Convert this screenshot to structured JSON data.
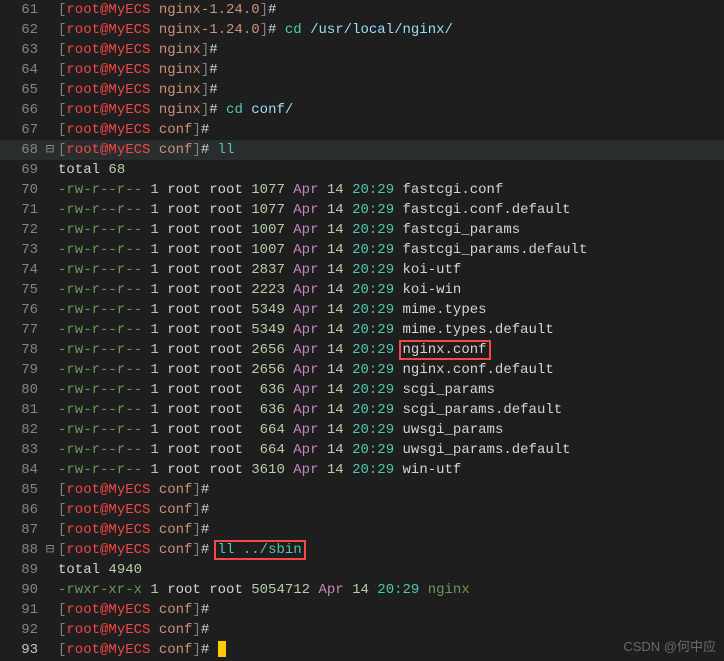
{
  "lines": [
    {
      "n": 61,
      "segs": [
        {
          "t": "[",
          "c": "c-br"
        },
        {
          "t": "root@MyECS",
          "c": "c-red"
        },
        {
          "t": " nginx-1.24.0",
          "c": "c-user"
        },
        {
          "t": "]",
          "c": "c-br"
        },
        {
          "t": "#",
          "c": "c-hash"
        },
        {
          "t": " ",
          "c": ""
        }
      ]
    },
    {
      "n": 62,
      "segs": [
        {
          "t": "[",
          "c": "c-br"
        },
        {
          "t": "root@MyECS",
          "c": "c-red"
        },
        {
          "t": " nginx-1.24.0",
          "c": "c-user"
        },
        {
          "t": "]",
          "c": "c-br"
        },
        {
          "t": "#",
          "c": "c-hash"
        },
        {
          "t": " cd",
          "c": "c-cmd"
        },
        {
          "t": " /usr/local/nginx/",
          "c": "c-dir"
        }
      ]
    },
    {
      "n": 63,
      "segs": [
        {
          "t": "[",
          "c": "c-br"
        },
        {
          "t": "root@MyECS",
          "c": "c-red"
        },
        {
          "t": " nginx",
          "c": "c-user"
        },
        {
          "t": "]",
          "c": "c-br"
        },
        {
          "t": "#",
          "c": "c-hash"
        }
      ]
    },
    {
      "n": 64,
      "segs": [
        {
          "t": "[",
          "c": "c-br"
        },
        {
          "t": "root@MyECS",
          "c": "c-red"
        },
        {
          "t": " nginx",
          "c": "c-user"
        },
        {
          "t": "]",
          "c": "c-br"
        },
        {
          "t": "#",
          "c": "c-hash"
        }
      ]
    },
    {
      "n": 65,
      "segs": [
        {
          "t": "[",
          "c": "c-br"
        },
        {
          "t": "root@MyECS",
          "c": "c-red"
        },
        {
          "t": " nginx",
          "c": "c-user"
        },
        {
          "t": "]",
          "c": "c-br"
        },
        {
          "t": "#",
          "c": "c-hash"
        }
      ]
    },
    {
      "n": 66,
      "segs": [
        {
          "t": "[",
          "c": "c-br"
        },
        {
          "t": "root@MyECS",
          "c": "c-red"
        },
        {
          "t": " nginx",
          "c": "c-user"
        },
        {
          "t": "]",
          "c": "c-br"
        },
        {
          "t": "#",
          "c": "c-hash"
        },
        {
          "t": " cd",
          "c": "c-cmd"
        },
        {
          "t": " conf/",
          "c": "c-dir"
        }
      ]
    },
    {
      "n": 67,
      "segs": [
        {
          "t": "[",
          "c": "c-br"
        },
        {
          "t": "root@MyECS",
          "c": "c-red"
        },
        {
          "t": " conf",
          "c": "c-user"
        },
        {
          "t": "]",
          "c": "c-br"
        },
        {
          "t": "#",
          "c": "c-hash"
        }
      ]
    },
    {
      "n": 68,
      "fold": "⊟",
      "hl": true,
      "segs": [
        {
          "t": "[",
          "c": "c-br"
        },
        {
          "t": "root@MyECS",
          "c": "c-red"
        },
        {
          "t": " conf",
          "c": "c-user"
        },
        {
          "t": "]",
          "c": "c-br"
        },
        {
          "t": "#",
          "c": "c-hash"
        },
        {
          "t": " ll",
          "c": "c-cmd"
        }
      ]
    },
    {
      "n": 69,
      "segs": [
        {
          "t": "total ",
          "c": "c-file"
        },
        {
          "t": "68",
          "c": "c-num"
        }
      ]
    },
    {
      "n": 70,
      "segs": [
        {
          "t": "-rw-r--r--",
          "c": "c-green"
        },
        {
          "t": " 1",
          "c": "c-num"
        },
        {
          "t": " root root ",
          "c": "c-file"
        },
        {
          "t": "1077",
          "c": "c-num"
        },
        {
          "t": " Apr",
          "c": "c-mon"
        },
        {
          "t": " 14",
          "c": "c-day"
        },
        {
          "t": " 20:29",
          "c": "c-time"
        },
        {
          "t": " fastcgi.conf",
          "c": "c-file"
        }
      ]
    },
    {
      "n": 71,
      "segs": [
        {
          "t": "-rw-r--r--",
          "c": "c-green"
        },
        {
          "t": " 1",
          "c": "c-num"
        },
        {
          "t": " root root ",
          "c": "c-file"
        },
        {
          "t": "1077",
          "c": "c-num"
        },
        {
          "t": " Apr",
          "c": "c-mon"
        },
        {
          "t": " 14",
          "c": "c-day"
        },
        {
          "t": " 20:29",
          "c": "c-time"
        },
        {
          "t": " fastcgi.conf.default",
          "c": "c-file"
        }
      ]
    },
    {
      "n": 72,
      "segs": [
        {
          "t": "-rw-r--r--",
          "c": "c-green"
        },
        {
          "t": " 1",
          "c": "c-num"
        },
        {
          "t": " root root ",
          "c": "c-file"
        },
        {
          "t": "1007",
          "c": "c-num"
        },
        {
          "t": " Apr",
          "c": "c-mon"
        },
        {
          "t": " 14",
          "c": "c-day"
        },
        {
          "t": " 20:29",
          "c": "c-time"
        },
        {
          "t": " fastcgi_params",
          "c": "c-file"
        }
      ]
    },
    {
      "n": 73,
      "segs": [
        {
          "t": "-rw-r--r--",
          "c": "c-green"
        },
        {
          "t": " 1",
          "c": "c-num"
        },
        {
          "t": " root root ",
          "c": "c-file"
        },
        {
          "t": "1007",
          "c": "c-num"
        },
        {
          "t": " Apr",
          "c": "c-mon"
        },
        {
          "t": " 14",
          "c": "c-day"
        },
        {
          "t": " 20:29",
          "c": "c-time"
        },
        {
          "t": " fastcgi_params.default",
          "c": "c-file"
        }
      ]
    },
    {
      "n": 74,
      "segs": [
        {
          "t": "-rw-r--r--",
          "c": "c-green"
        },
        {
          "t": " 1",
          "c": "c-num"
        },
        {
          "t": " root root ",
          "c": "c-file"
        },
        {
          "t": "2837",
          "c": "c-num"
        },
        {
          "t": " Apr",
          "c": "c-mon"
        },
        {
          "t": " 14",
          "c": "c-day"
        },
        {
          "t": " 20:29",
          "c": "c-time"
        },
        {
          "t": " koi-utf",
          "c": "c-file"
        }
      ]
    },
    {
      "n": 75,
      "segs": [
        {
          "t": "-rw-r--r--",
          "c": "c-green"
        },
        {
          "t": " 1",
          "c": "c-num"
        },
        {
          "t": " root root ",
          "c": "c-file"
        },
        {
          "t": "2223",
          "c": "c-num"
        },
        {
          "t": " Apr",
          "c": "c-mon"
        },
        {
          "t": " 14",
          "c": "c-day"
        },
        {
          "t": " 20:29",
          "c": "c-time"
        },
        {
          "t": " koi-win",
          "c": "c-file"
        }
      ]
    },
    {
      "n": 76,
      "segs": [
        {
          "t": "-rw-r--r--",
          "c": "c-green"
        },
        {
          "t": " 1",
          "c": "c-num"
        },
        {
          "t": " root root ",
          "c": "c-file"
        },
        {
          "t": "5349",
          "c": "c-num"
        },
        {
          "t": " Apr",
          "c": "c-mon"
        },
        {
          "t": " 14",
          "c": "c-day"
        },
        {
          "t": " 20:29",
          "c": "c-time"
        },
        {
          "t": " mime.types",
          "c": "c-file"
        }
      ]
    },
    {
      "n": 77,
      "segs": [
        {
          "t": "-rw-r--r--",
          "c": "c-green"
        },
        {
          "t": " 1",
          "c": "c-num"
        },
        {
          "t": " root root ",
          "c": "c-file"
        },
        {
          "t": "5349",
          "c": "c-num"
        },
        {
          "t": " Apr",
          "c": "c-mon"
        },
        {
          "t": " 14",
          "c": "c-day"
        },
        {
          "t": " 20:29",
          "c": "c-time"
        },
        {
          "t": " mime.types.default",
          "c": "c-file"
        }
      ]
    },
    {
      "n": 78,
      "segs": [
        {
          "t": "-rw-r--r--",
          "c": "c-green"
        },
        {
          "t": " 1",
          "c": "c-num"
        },
        {
          "t": " root root ",
          "c": "c-file"
        },
        {
          "t": "2656",
          "c": "c-num"
        },
        {
          "t": " Apr",
          "c": "c-mon"
        },
        {
          "t": " 14",
          "c": "c-day"
        },
        {
          "t": " 20:29",
          "c": "c-time"
        },
        {
          "t": " ",
          "c": ""
        },
        {
          "t": "nginx.conf",
          "c": "c-file",
          "box": true
        }
      ]
    },
    {
      "n": 79,
      "segs": [
        {
          "t": "-rw-r--r--",
          "c": "c-green"
        },
        {
          "t": " 1",
          "c": "c-num"
        },
        {
          "t": " root root ",
          "c": "c-file"
        },
        {
          "t": "2656",
          "c": "c-num"
        },
        {
          "t": " Apr",
          "c": "c-mon"
        },
        {
          "t": " 14",
          "c": "c-day"
        },
        {
          "t": " 20:29",
          "c": "c-time"
        },
        {
          "t": " nginx.conf.default",
          "c": "c-file"
        }
      ]
    },
    {
      "n": 80,
      "segs": [
        {
          "t": "-rw-r--r--",
          "c": "c-green"
        },
        {
          "t": " 1",
          "c": "c-num"
        },
        {
          "t": " root root  ",
          "c": "c-file"
        },
        {
          "t": "636",
          "c": "c-num"
        },
        {
          "t": " Apr",
          "c": "c-mon"
        },
        {
          "t": " 14",
          "c": "c-day"
        },
        {
          "t": " 20:29",
          "c": "c-time"
        },
        {
          "t": " scgi_params",
          "c": "c-file"
        }
      ]
    },
    {
      "n": 81,
      "segs": [
        {
          "t": "-rw-r--r--",
          "c": "c-green"
        },
        {
          "t": " 1",
          "c": "c-num"
        },
        {
          "t": " root root  ",
          "c": "c-file"
        },
        {
          "t": "636",
          "c": "c-num"
        },
        {
          "t": " Apr",
          "c": "c-mon"
        },
        {
          "t": " 14",
          "c": "c-day"
        },
        {
          "t": " 20:29",
          "c": "c-time"
        },
        {
          "t": " scgi_params.default",
          "c": "c-file"
        }
      ]
    },
    {
      "n": 82,
      "segs": [
        {
          "t": "-rw-r--r--",
          "c": "c-green"
        },
        {
          "t": " 1",
          "c": "c-num"
        },
        {
          "t": " root root  ",
          "c": "c-file"
        },
        {
          "t": "664",
          "c": "c-num"
        },
        {
          "t": " Apr",
          "c": "c-mon"
        },
        {
          "t": " 14",
          "c": "c-day"
        },
        {
          "t": " 20:29",
          "c": "c-time"
        },
        {
          "t": " uwsgi_params",
          "c": "c-file"
        }
      ]
    },
    {
      "n": 83,
      "segs": [
        {
          "t": "-rw-r--r--",
          "c": "c-green"
        },
        {
          "t": " 1",
          "c": "c-num"
        },
        {
          "t": " root root  ",
          "c": "c-file"
        },
        {
          "t": "664",
          "c": "c-num"
        },
        {
          "t": " Apr",
          "c": "c-mon"
        },
        {
          "t": " 14",
          "c": "c-day"
        },
        {
          "t": " 20:29",
          "c": "c-time"
        },
        {
          "t": " uwsgi_params.default",
          "c": "c-file"
        }
      ]
    },
    {
      "n": 84,
      "segs": [
        {
          "t": "-rw-r--r--",
          "c": "c-green"
        },
        {
          "t": " 1",
          "c": "c-num"
        },
        {
          "t": " root root ",
          "c": "c-file"
        },
        {
          "t": "3610",
          "c": "c-num"
        },
        {
          "t": " Apr",
          "c": "c-mon"
        },
        {
          "t": " 14",
          "c": "c-day"
        },
        {
          "t": " 20:29",
          "c": "c-time"
        },
        {
          "t": " win-utf",
          "c": "c-file"
        }
      ]
    },
    {
      "n": 85,
      "segs": [
        {
          "t": "[",
          "c": "c-br"
        },
        {
          "t": "root@MyECS",
          "c": "c-red"
        },
        {
          "t": " conf",
          "c": "c-user"
        },
        {
          "t": "]",
          "c": "c-br"
        },
        {
          "t": "#",
          "c": "c-hash"
        }
      ]
    },
    {
      "n": 86,
      "segs": [
        {
          "t": "[",
          "c": "c-br"
        },
        {
          "t": "root@MyECS",
          "c": "c-red"
        },
        {
          "t": " conf",
          "c": "c-user"
        },
        {
          "t": "]",
          "c": "c-br"
        },
        {
          "t": "#",
          "c": "c-hash"
        }
      ]
    },
    {
      "n": 87,
      "segs": [
        {
          "t": "[",
          "c": "c-br"
        },
        {
          "t": "root@MyECS",
          "c": "c-red"
        },
        {
          "t": " conf",
          "c": "c-user"
        },
        {
          "t": "]",
          "c": "c-br"
        },
        {
          "t": "#",
          "c": "c-hash"
        }
      ]
    },
    {
      "n": 88,
      "fold": "⊟",
      "segs": [
        {
          "t": "[",
          "c": "c-br"
        },
        {
          "t": "root@MyECS",
          "c": "c-red"
        },
        {
          "t": " conf",
          "c": "c-user"
        },
        {
          "t": "]",
          "c": "c-br"
        },
        {
          "t": "#",
          "c": "c-hash"
        },
        {
          "t": " ",
          "c": ""
        },
        {
          "t": "ll ../sbin",
          "c": "c-cmd",
          "box": true
        }
      ]
    },
    {
      "n": 89,
      "segs": [
        {
          "t": "total ",
          "c": "c-file"
        },
        {
          "t": "4940",
          "c": "c-num"
        }
      ]
    },
    {
      "n": 90,
      "segs": [
        {
          "t": "-rwxr-xr-x",
          "c": "c-perm-x"
        },
        {
          "t": " 1",
          "c": "c-num"
        },
        {
          "t": " root root ",
          "c": "c-file"
        },
        {
          "t": "5054712",
          "c": "c-num"
        },
        {
          "t": " Apr",
          "c": "c-mon"
        },
        {
          "t": " 14",
          "c": "c-day"
        },
        {
          "t": " 20:29",
          "c": "c-time"
        },
        {
          "t": " ",
          "c": ""
        },
        {
          "t": "nginx",
          "c": "c-exec"
        }
      ]
    },
    {
      "n": 91,
      "segs": [
        {
          "t": "[",
          "c": "c-br"
        },
        {
          "t": "root@MyECS",
          "c": "c-red"
        },
        {
          "t": " conf",
          "c": "c-user"
        },
        {
          "t": "]",
          "c": "c-br"
        },
        {
          "t": "#",
          "c": "c-hash"
        }
      ]
    },
    {
      "n": 92,
      "segs": [
        {
          "t": "[",
          "c": "c-br"
        },
        {
          "t": "root@MyECS",
          "c": "c-red"
        },
        {
          "t": " conf",
          "c": "c-user"
        },
        {
          "t": "]",
          "c": "c-br"
        },
        {
          "t": "#",
          "c": "c-hash"
        }
      ]
    },
    {
      "n": 93,
      "active": true,
      "cursor": true,
      "segs": [
        {
          "t": "[",
          "c": "c-br"
        },
        {
          "t": "root@MyECS",
          "c": "c-red"
        },
        {
          "t": " conf",
          "c": "c-user"
        },
        {
          "t": "]",
          "c": "c-br"
        },
        {
          "t": "#",
          "c": "c-hash"
        },
        {
          "t": " ",
          "c": ""
        }
      ]
    }
  ],
  "watermark": "CSDN @何中应"
}
